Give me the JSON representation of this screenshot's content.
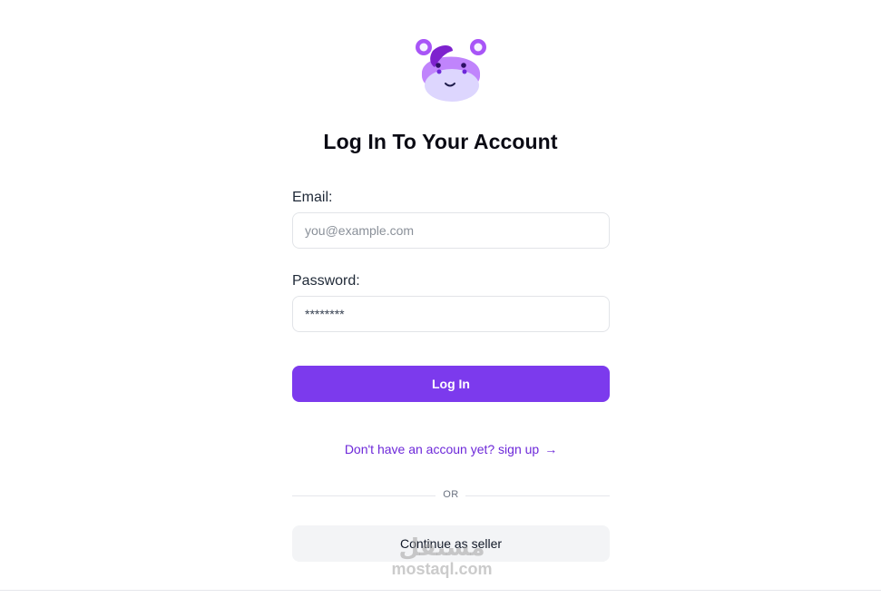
{
  "brand": {
    "logo_icon": "hippo-mascot-icon",
    "colors": {
      "primary": "#7c3aed",
      "logo_light": "#c084fc",
      "logo_dark": "#6d28d9",
      "logo_snout": "#ddd6fe"
    }
  },
  "heading": {
    "title": "Log In To Your Account"
  },
  "form": {
    "email_label": "Email:",
    "email_placeholder": "you@example.com",
    "password_label": "Password:",
    "password_value": "********",
    "login_button": "Log In"
  },
  "signup": {
    "text": "Don't have an accoun yet? sign up",
    "arrow_icon": "arrow-right-icon"
  },
  "divider": {
    "text": "OR"
  },
  "seller": {
    "button": "Continue as seller"
  },
  "watermark": {
    "arabic": "مستقل",
    "latin": "mostaql.com"
  }
}
